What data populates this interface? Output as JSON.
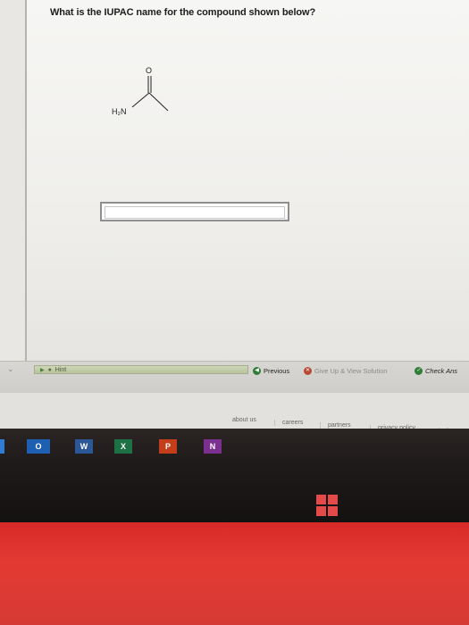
{
  "question": {
    "text": "What is the IUPAC name for the compound shown below?"
  },
  "molecule": {
    "oxygen_label": "O",
    "amine_label": "H₂N"
  },
  "answer": {
    "value": "",
    "placeholder": ""
  },
  "nav": {
    "hint_label": "Hint",
    "previous_label": "Previous",
    "giveup_label": "Give Up & View Solution",
    "check_label": "Check Ans"
  },
  "footer": {
    "links": [
      "about us",
      "careers",
      "partners",
      "privacy policy",
      "terms"
    ]
  },
  "taskbar": {
    "apps": [
      {
        "name": "outlook",
        "letter": "O"
      },
      {
        "name": "word",
        "letter": "W"
      },
      {
        "name": "excel",
        "letter": "X"
      },
      {
        "name": "powerpoint",
        "letter": "P"
      },
      {
        "name": "onenote",
        "letter": "N"
      }
    ]
  },
  "colors": {
    "accent_green": "#2f7d36",
    "giveup_red": "#b84a33",
    "bezel_red": "#d82a28",
    "windows_logo": "#e44a4a"
  }
}
